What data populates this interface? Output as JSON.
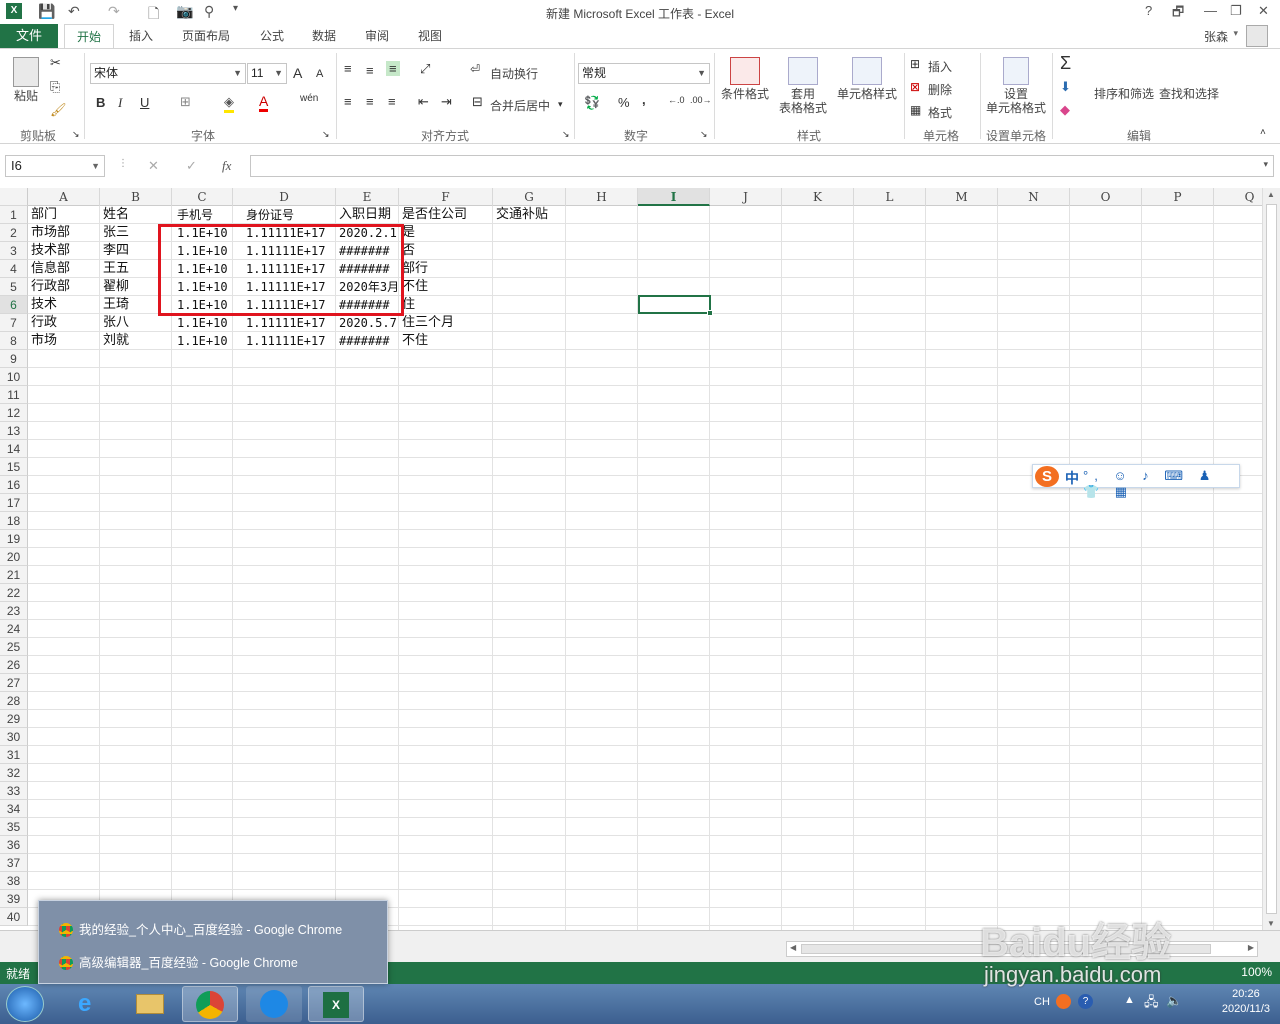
{
  "window": {
    "title": "新建 Microsoft Excel 工作表 - Excel",
    "controls": {
      "help": "?",
      "restore": "🗗",
      "minimize": "—",
      "maximize": "❐",
      "close": "✕"
    }
  },
  "tabs": {
    "file": "文件",
    "items": [
      "开始",
      "插入",
      "页面布局",
      "公式",
      "数据",
      "审阅",
      "视图"
    ],
    "active": "开始",
    "user": "张森"
  },
  "ribbon": {
    "clipboard": {
      "label": "剪贴板",
      "paste": "粘贴"
    },
    "font": {
      "label": "字体",
      "name": "宋体",
      "size": "11",
      "bold": "B",
      "italic": "I",
      "underline": "U",
      "grow": "A",
      "shrink": "A",
      "color_letter": "A",
      "wen": "wén"
    },
    "alignment": {
      "label": "对齐方式",
      "wrap": "自动换行",
      "merge": "合并后居中"
    },
    "number": {
      "label": "数字",
      "format": "常规",
      "percent": "%",
      "comma": ","
    },
    "styles": {
      "label": "样式",
      "conditional": "条件格式",
      "table_line1": "套用",
      "table_line2": "表格格式",
      "cell_styles": "单元格样式"
    },
    "cells": {
      "label": "单元格",
      "insert": "插入",
      "delete": "删除",
      "format": "格式"
    },
    "format_cells": {
      "label": "设置单元格",
      "line1": "设置",
      "line2": "单元格格式"
    },
    "editing": {
      "label": "编辑",
      "sort": "排序和筛选",
      "find": "查找和选择",
      "sigma": "Σ"
    }
  },
  "formula_bar": {
    "name_box": "I6",
    "fx": "fx",
    "cancel": "✕",
    "enter": "✓",
    "value": ""
  },
  "columns": [
    "A",
    "B",
    "C",
    "D",
    "E",
    "F",
    "G",
    "H",
    "I",
    "J",
    "K",
    "L",
    "M",
    "N",
    "O",
    "P",
    "Q"
  ],
  "selected_column": "I",
  "selected_row": "6",
  "rows": [
    "1",
    "2",
    "3",
    "4",
    "5",
    "6",
    "7",
    "8",
    "9",
    "10",
    "11",
    "12",
    "13",
    "14",
    "15",
    "16",
    "17",
    "18",
    "19",
    "20",
    "21",
    "22",
    "23",
    "24",
    "25",
    "26",
    "27",
    "28",
    "29",
    "30",
    "31",
    "32",
    "33",
    "34",
    "35",
    "36",
    "37",
    "38",
    "39",
    "40"
  ],
  "sheet": [
    [
      "部门",
      "姓名",
      "手机号",
      "身份证号",
      "入职日期",
      "是否住公司",
      "交通补贴"
    ],
    [
      "市场部",
      "张三",
      "1.1E+10",
      "1.11111E+17",
      "2020.2.1",
      "是",
      ""
    ],
    [
      "技术部",
      "李四",
      "1.1E+10",
      "1.11111E+17",
      "#######",
      "否",
      ""
    ],
    [
      "信息部",
      "王五",
      "1.1E+10",
      "1.11111E+17",
      "#######",
      "部行",
      ""
    ],
    [
      "行政部",
      "翟柳",
      "1.1E+10",
      "1.11111E+17",
      "2020年3月",
      "不住",
      ""
    ],
    [
      "技术",
      "王琦",
      "1.1E+10",
      "1.11111E+17",
      "#######",
      "住",
      ""
    ],
    [
      "行政",
      "张八",
      "1.1E+10",
      "1.11111E+17",
      "2020.5.7",
      "住三个月",
      ""
    ],
    [
      "市场",
      "刘就",
      "1.1E+10",
      "1.11111E+17",
      "#######",
      "不住",
      ""
    ]
  ],
  "status": {
    "ready": "就绪",
    "zoom": "100%"
  },
  "taskbar": {
    "popup": [
      "我的经验_个人中心_百度经验 - Google Chrome",
      "高级编辑器_百度经验 - Google Chrome"
    ],
    "ime_lang": "CH",
    "time": "20:26",
    "date": "2020/11/3"
  },
  "ime": {
    "logo": "S",
    "mode": "中",
    "icons": "°, ☺ ♪ ⌨ ♟ 👕 ▦"
  },
  "watermark": {
    "brand": "Baidu经验",
    "url": "jingyan.baidu.com"
  },
  "colors": {
    "excel_green": "#217346",
    "highlight_red": "#e0141e"
  }
}
